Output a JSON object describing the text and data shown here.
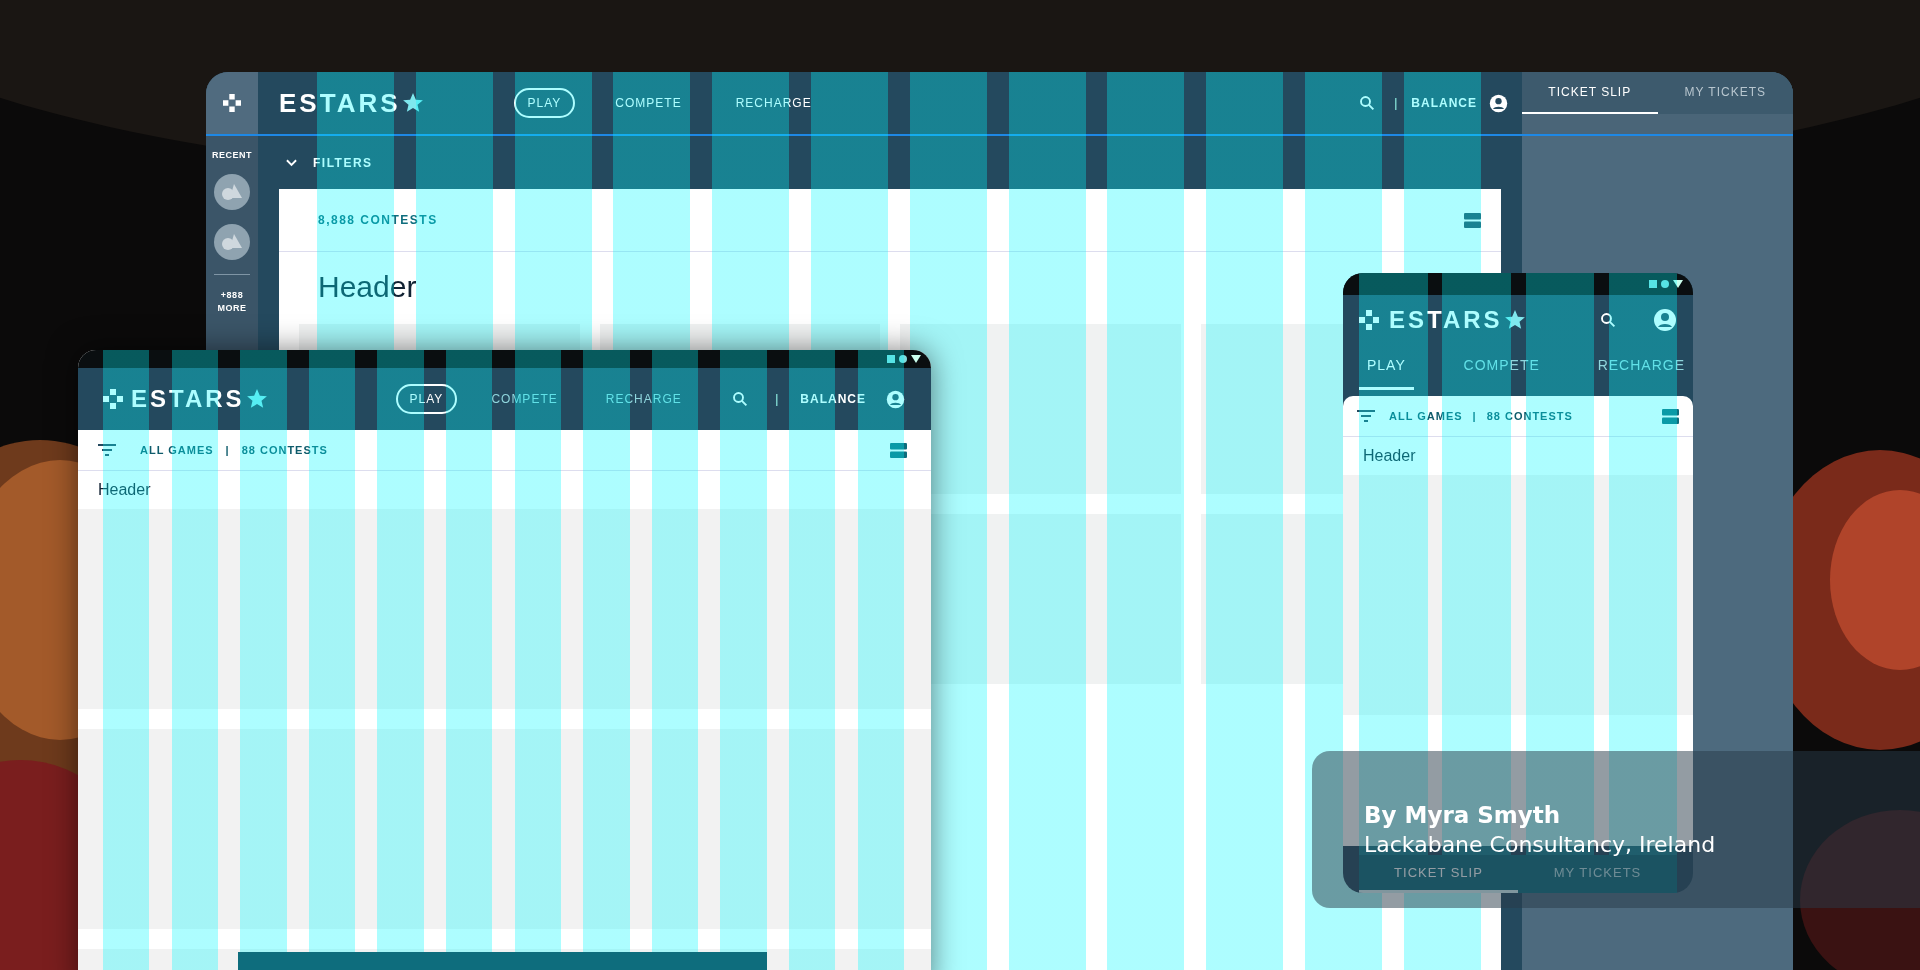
{
  "desktop": {
    "brand": "ESTARS",
    "nav": [
      {
        "label": "PLAY",
        "selected": true
      },
      {
        "label": "COMPETE",
        "selected": false
      },
      {
        "label": "RECHARGE",
        "selected": false
      }
    ],
    "balance": "BALANCE",
    "separator": "|",
    "rail": {
      "title": "RECENT",
      "more": "+888 MORE"
    },
    "filters": "FILTERS",
    "count": "8,888 CONTESTS",
    "header": "Header",
    "side_tabs": [
      {
        "label": "TICKET SLIP",
        "selected": true
      },
      {
        "label": "MY TICKETS",
        "selected": false
      }
    ]
  },
  "tablet": {
    "brand": "ESTARS",
    "nav": [
      {
        "label": "PLAY",
        "selected": true
      },
      {
        "label": "COMPETE",
        "selected": false
      },
      {
        "label": "RECHARGE",
        "selected": false
      }
    ],
    "balance": "BALANCE",
    "separator": "|",
    "games": "ALL GAMES",
    "count": "88 CONTESTS",
    "header": "Header"
  },
  "phone": {
    "brand": "ESTARS",
    "nav": [
      {
        "label": "PLAY",
        "selected": true
      },
      {
        "label": "COMPETE",
        "selected": false
      },
      {
        "label": "RECHARGE",
        "selected": false
      }
    ],
    "separator": "|",
    "games": "ALL GAMES",
    "count": "88 CONTESTS",
    "header": "Header",
    "bottom_tabs": [
      {
        "label": "TICKET SLIP",
        "selected": true
      },
      {
        "label": "MY TICKETS",
        "selected": false
      }
    ]
  },
  "credit": {
    "author": "By Myra Smyth",
    "company": "Lackabane Consultancy, Ireland"
  }
}
